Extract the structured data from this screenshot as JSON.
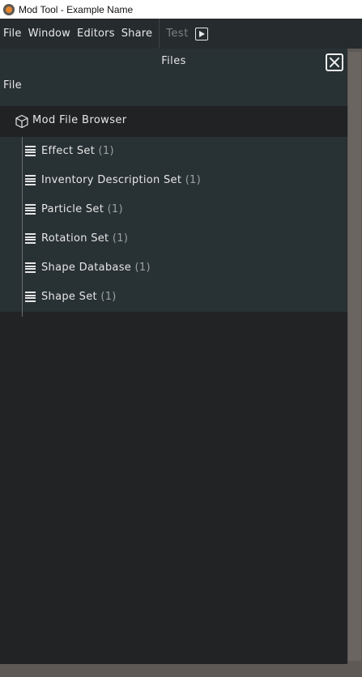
{
  "window": {
    "title": "Mod Tool - Example Name"
  },
  "menubar": {
    "items": [
      "File",
      "Window",
      "Editors",
      "Share"
    ],
    "test_label": "Test"
  },
  "panel": {
    "title": "Files",
    "file_label": "File",
    "tree": {
      "root_label": "Mod File Browser",
      "items": [
        {
          "label": "Effect Set",
          "count": "(1)"
        },
        {
          "label": "Inventory Description Set",
          "count": "(1)"
        },
        {
          "label": "Particle Set",
          "count": "(1)"
        },
        {
          "label": "Rotation Set",
          "count": "(1)"
        },
        {
          "label": "Shape Database",
          "count": "(1)"
        },
        {
          "label": "Shape Set",
          "count": "(1)"
        }
      ]
    }
  },
  "icons": {
    "app": "app-logo-icon",
    "play": "play-icon",
    "close": "close-icon",
    "root": "cube-icon",
    "item": "list-icon"
  },
  "colors": {
    "menubar_bg": "#262b2d",
    "panel_bg": "#222325",
    "tree_child_bg": "#283134",
    "text": "#e6e6e6",
    "muted_text": "#7c8285",
    "accent_app": "#e8862a"
  }
}
